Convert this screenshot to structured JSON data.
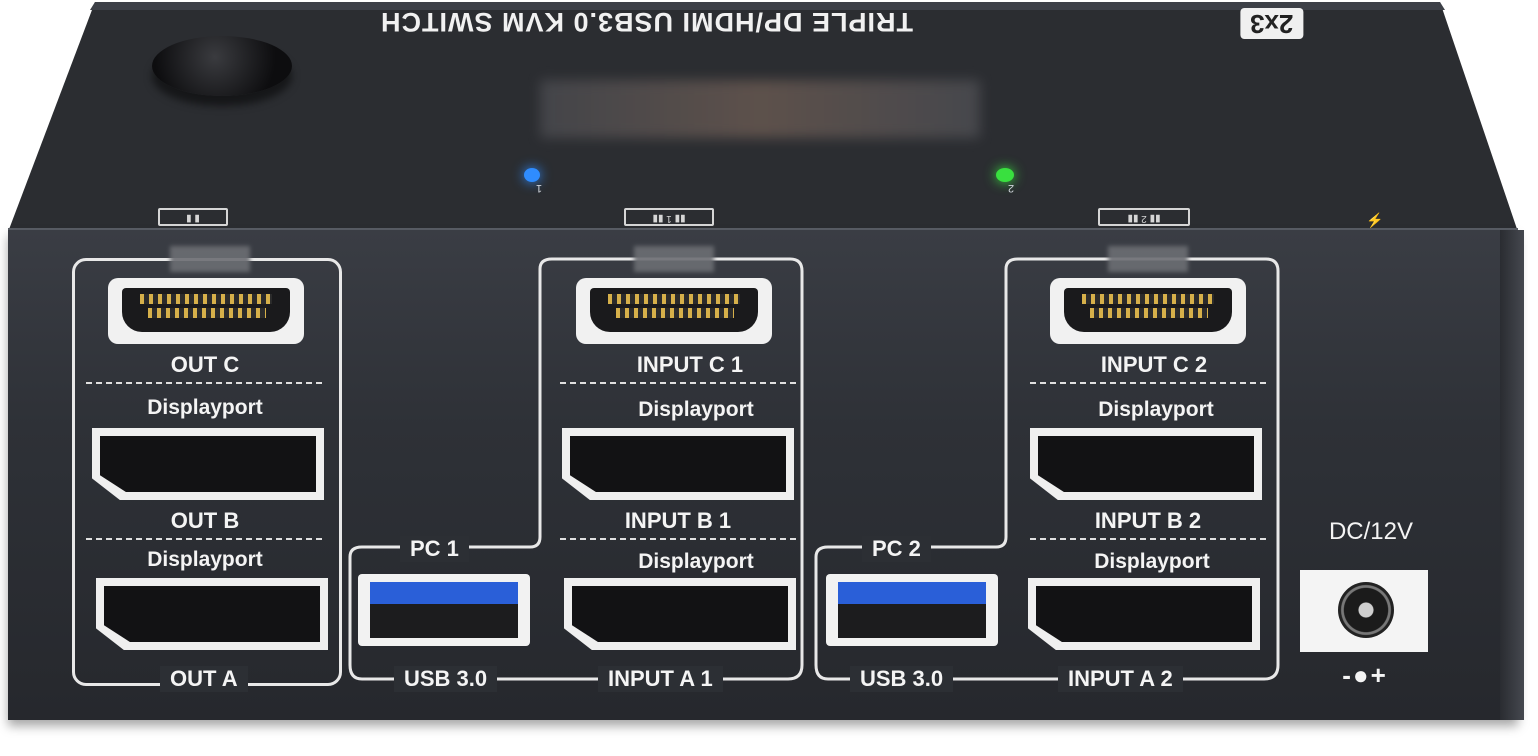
{
  "device": {
    "top_title": "TRIPLE DP/HDMI USB3.0 KVM SWITCH",
    "top_badge": "2x3",
    "led_1_label": "1",
    "led_2_label": "2",
    "colors": {
      "led_1": "#2f8cff",
      "led_2": "#39e03f",
      "body": "#2e3137",
      "usb_port": "#2a5fd8"
    }
  },
  "outputs": {
    "out_c": "OUT C",
    "out_b_type": "Displayport",
    "out_b": "OUT B",
    "out_a_type": "Displayport",
    "out_a": "OUT A"
  },
  "pc1": {
    "label": "PC 1",
    "input_c": "INPUT C 1",
    "input_b_type": "Displayport",
    "input_b": "INPUT B 1",
    "input_a_type": "Displayport",
    "input_a": "INPUT A 1",
    "usb": "USB 3.0"
  },
  "pc2": {
    "label": "PC 2",
    "input_c": "INPUT C 2",
    "input_b_type": "Displayport",
    "input_b": "INPUT B 2",
    "input_a_type": "Displayport",
    "input_a": "INPUT A 2",
    "usb": "USB 3.0"
  },
  "power": {
    "label": "DC/12V",
    "polarity": "-●+"
  }
}
